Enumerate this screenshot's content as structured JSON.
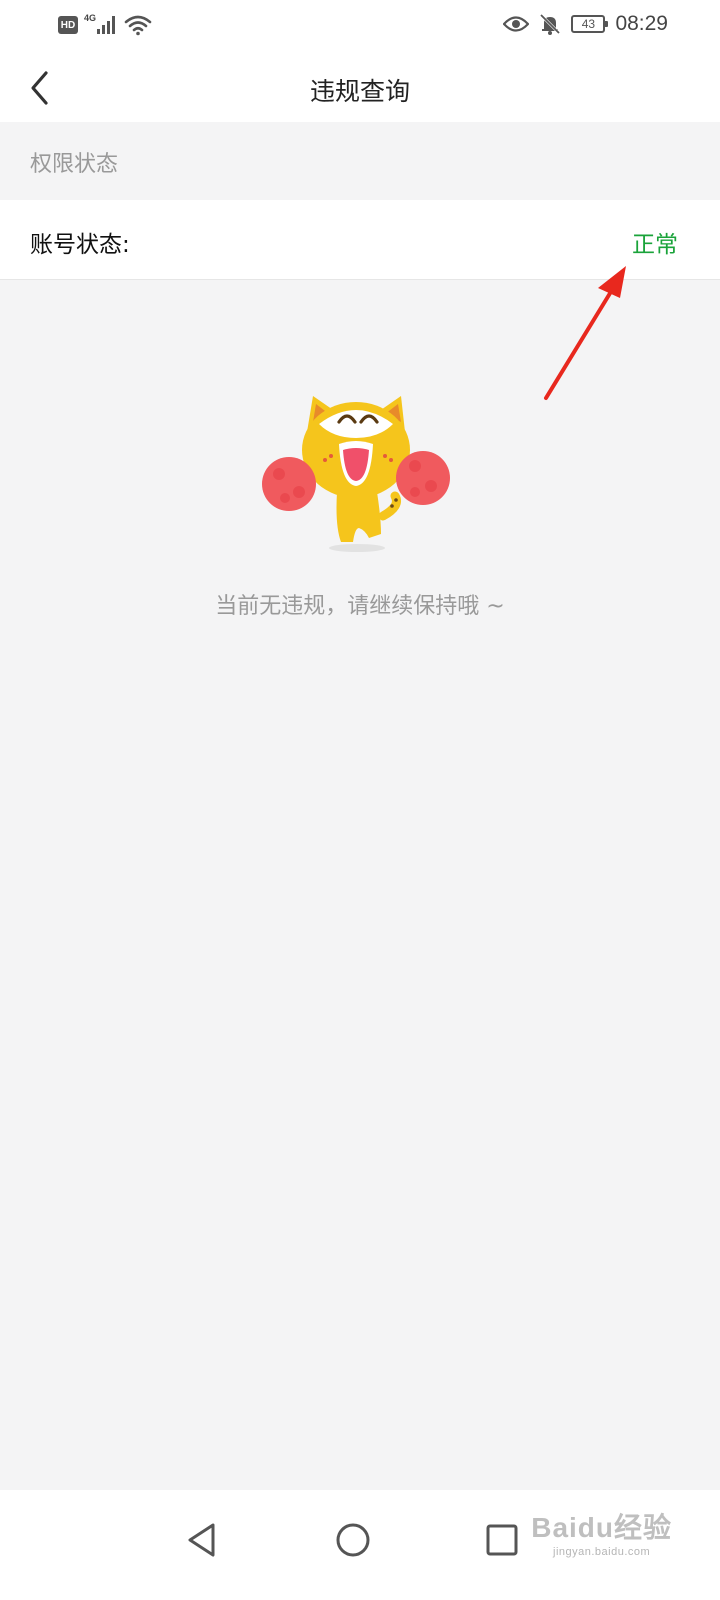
{
  "status_bar": {
    "hd": "HD",
    "network": "4G",
    "battery": "43",
    "time": "08:29",
    "icons": [
      "signal-icon",
      "wifi-icon",
      "eye-icon",
      "mute-bell-icon",
      "battery-icon"
    ]
  },
  "header": {
    "title": "违规查询",
    "back_icon": "chevron-left-icon"
  },
  "permission_section": {
    "label": "权限状态"
  },
  "account_status": {
    "label": "账号状态:",
    "value": "正常"
  },
  "empty_state": {
    "message": "当前无违规，请继续保持哦 ~",
    "illustration": "cheering-cat-mascot"
  },
  "nav_bar": {
    "icons": [
      "back-triangle-icon",
      "home-circle-icon",
      "recents-square-icon"
    ]
  },
  "watermark": {
    "brand": "Baidu经验",
    "url": "jingyan.baidu.com"
  },
  "colors": {
    "status_ok": "#1aa33a",
    "annotation_arrow": "#e8281e",
    "background": "#f4f4f5"
  }
}
